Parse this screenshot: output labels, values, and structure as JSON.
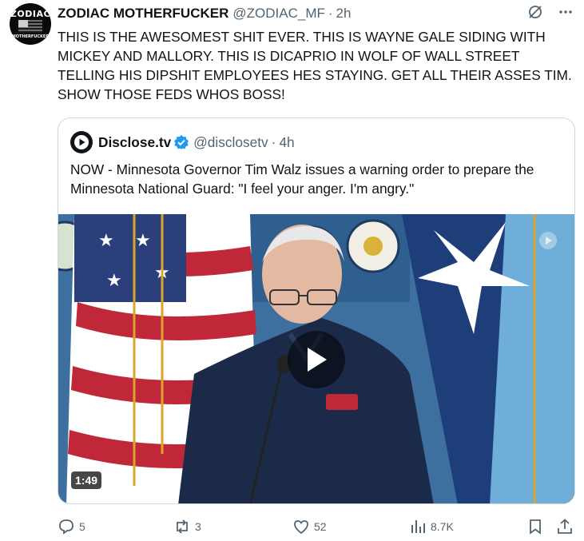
{
  "author": {
    "name": "ZODIAC MOTHERFUCKER",
    "handle": "@ZODIAC_MF",
    "separator": "·",
    "time": "2h",
    "avatar_top_text": "ZODIAC",
    "avatar_bottom_text": "MOTHERFUCKER"
  },
  "tweet_text": "THIS IS THE AWESOMEST SHIT EVER. THIS IS WAYNE GALE SIDING WITH MICKEY AND MALLORY. THIS IS DICAPRIO IN WOLF OF WALL STREET TELLING HIS DIPSHIT EMPLOYEES HES STAYING. GET ALL THEIR ASSES TIM. SHOW THOSE FEDS WHOS BOSS!",
  "top_icons": [
    "grok-icon",
    "more-icon"
  ],
  "quote": {
    "name": "Disclose.tv",
    "handle": "@disclosetv",
    "separator": "·",
    "time": "4h",
    "text": "NOW - Minnesota Governor Tim Walz issues a warning order to prepare the Minnesota National Guard: \"I feel your anger. I'm angry.\"",
    "verified_color": "#1d9bf0",
    "video_duration": "1:49"
  },
  "actions": {
    "replies": "5",
    "reposts": "3",
    "likes": "52",
    "views": "8.7K"
  },
  "colors": {
    "text": "#0f1419",
    "secondary": "#536471",
    "border": "#cfd9de",
    "accent": "#1d9bf0"
  }
}
